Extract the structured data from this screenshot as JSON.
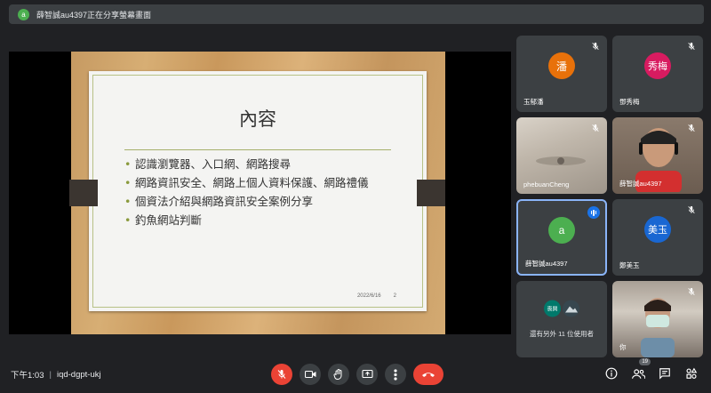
{
  "banner": {
    "avatar_letter": "a",
    "text": "薛智誠au4397正在分享螢幕畫面"
  },
  "slide": {
    "title": "內容",
    "bullets": [
      "認識瀏覽器、入口網、網路搜尋",
      "網路資訊安全、網路上個人資料保護、網路禮儀",
      "個資法介紹與網路資訊安全案例分享",
      "釣魚網站判斷"
    ],
    "date": "2022/6/16",
    "page": "2"
  },
  "participants": [
    {
      "name": "玉郁潘",
      "initial": "潘",
      "color": "#e8710a"
    },
    {
      "name": "鄧秀梅",
      "initial": "秀梅",
      "color": "#d81b60"
    },
    {
      "name": "phebuanCheng"
    },
    {
      "name": "薛智誠au4397"
    },
    {
      "name": "薛智誠au4397",
      "initial": "a",
      "color": "#4caf50"
    },
    {
      "name": "鄭美玉",
      "initial": "美玉",
      "color": "#1967d2"
    },
    {
      "more_text": "還有另外 11 位使用者",
      "mini1": "喪興",
      "mini2": ""
    },
    {
      "name": "你"
    }
  ],
  "bottom": {
    "time": "下午1:03",
    "separator": "|",
    "meeting_code": "iqd-dgpt-ukj",
    "participant_count": "19"
  },
  "colors": {
    "end_call": "#ea4335",
    "active_border": "#8ab4f8",
    "accent": "#1a73e8"
  }
}
